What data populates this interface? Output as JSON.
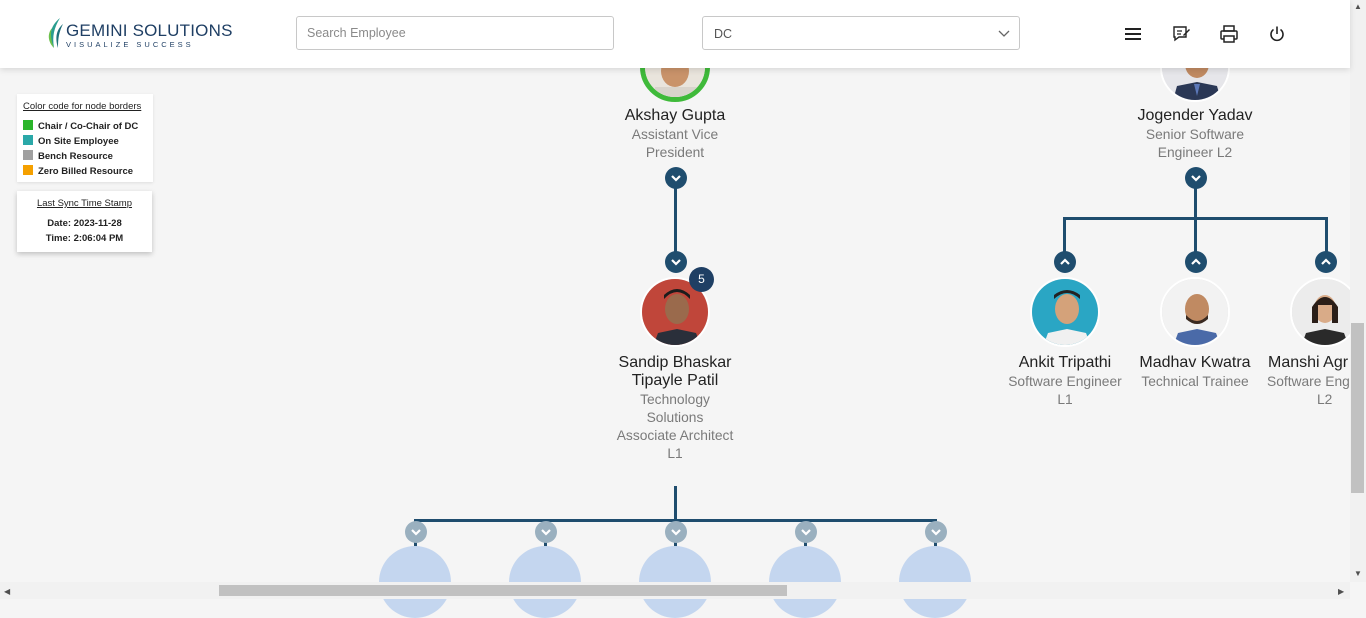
{
  "header": {
    "logo_main": "GEMINI SOLUTIONS",
    "logo_sub": "VISUALIZE SUCCESS",
    "search_placeholder": "Search Employee",
    "dc_value": "DC",
    "icons": [
      "menu-icon",
      "feedback-icon",
      "print-icon",
      "power-icon"
    ]
  },
  "legend": {
    "title": "Color code for node borders",
    "items": [
      {
        "label": "Chair / Co-Chair of DC",
        "color": "#2ab52a"
      },
      {
        "label": "On Site Employee",
        "color": "#2aa8a8"
      },
      {
        "label": "Bench Resource",
        "color": "#a0a0a0"
      },
      {
        "label": "Zero Billed Resource",
        "color": "#f5a000"
      }
    ]
  },
  "sync": {
    "title": "Last Sync Time Stamp",
    "date": "Date: 2023-11-28",
    "time": "Time: 2:06:04 PM"
  },
  "nodes": {
    "akshay": {
      "name": "Akshay Gupta",
      "title_1": "Assistant Vice",
      "title_2": "President"
    },
    "jogender": {
      "name": "Jogender Yadav",
      "title_1": "Senior Software",
      "title_2": "Engineer L2"
    },
    "sandip": {
      "name_1": "Sandip Bhaskar",
      "name_2": "Tipayle Patil",
      "title_1": "Technology",
      "title_2": "Solutions",
      "title_3": "Associate Architect",
      "title_4": "L1",
      "badge": "5"
    },
    "ankit": {
      "name": "Ankit Tripathi",
      "title_1": "Software Engineer",
      "title_2": "L1"
    },
    "madhav": {
      "name": "Madhav Kwatra",
      "title_1": "Technical Trainee"
    },
    "manshi": {
      "name": "Manshi Agr",
      "title_1": "Software Eng",
      "title_2": "L2"
    }
  },
  "colors": {
    "connector": "#1f4d6e",
    "chair_border": "#3fba3a",
    "badge": "#1f3f64"
  }
}
